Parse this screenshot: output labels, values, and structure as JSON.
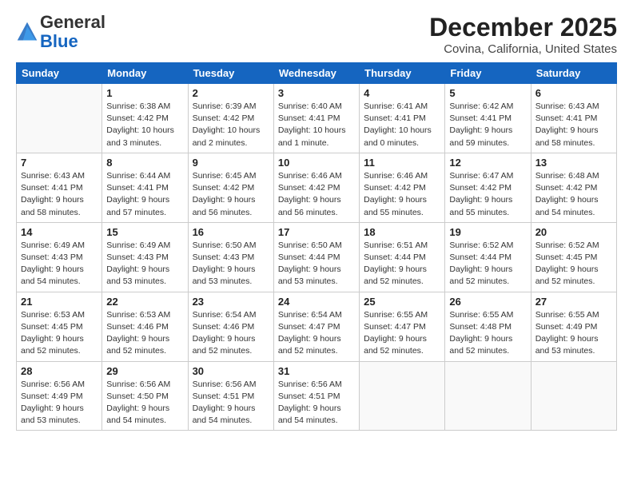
{
  "logo": {
    "general": "General",
    "blue": "Blue"
  },
  "header": {
    "month": "December 2025",
    "location": "Covina, California, United States"
  },
  "weekdays": [
    "Sunday",
    "Monday",
    "Tuesday",
    "Wednesday",
    "Thursday",
    "Friday",
    "Saturday"
  ],
  "weeks": [
    [
      {
        "day": "",
        "sunrise": "",
        "sunset": "",
        "daylight": ""
      },
      {
        "day": "1",
        "sunrise": "Sunrise: 6:38 AM",
        "sunset": "Sunset: 4:42 PM",
        "daylight": "Daylight: 10 hours and 3 minutes."
      },
      {
        "day": "2",
        "sunrise": "Sunrise: 6:39 AM",
        "sunset": "Sunset: 4:42 PM",
        "daylight": "Daylight: 10 hours and 2 minutes."
      },
      {
        "day": "3",
        "sunrise": "Sunrise: 6:40 AM",
        "sunset": "Sunset: 4:41 PM",
        "daylight": "Daylight: 10 hours and 1 minute."
      },
      {
        "day": "4",
        "sunrise": "Sunrise: 6:41 AM",
        "sunset": "Sunset: 4:41 PM",
        "daylight": "Daylight: 10 hours and 0 minutes."
      },
      {
        "day": "5",
        "sunrise": "Sunrise: 6:42 AM",
        "sunset": "Sunset: 4:41 PM",
        "daylight": "Daylight: 9 hours and 59 minutes."
      },
      {
        "day": "6",
        "sunrise": "Sunrise: 6:43 AM",
        "sunset": "Sunset: 4:41 PM",
        "daylight": "Daylight: 9 hours and 58 minutes."
      }
    ],
    [
      {
        "day": "7",
        "sunrise": "Sunrise: 6:43 AM",
        "sunset": "Sunset: 4:41 PM",
        "daylight": "Daylight: 9 hours and 58 minutes."
      },
      {
        "day": "8",
        "sunrise": "Sunrise: 6:44 AM",
        "sunset": "Sunset: 4:41 PM",
        "daylight": "Daylight: 9 hours and 57 minutes."
      },
      {
        "day": "9",
        "sunrise": "Sunrise: 6:45 AM",
        "sunset": "Sunset: 4:42 PM",
        "daylight": "Daylight: 9 hours and 56 minutes."
      },
      {
        "day": "10",
        "sunrise": "Sunrise: 6:46 AM",
        "sunset": "Sunset: 4:42 PM",
        "daylight": "Daylight: 9 hours and 56 minutes."
      },
      {
        "day": "11",
        "sunrise": "Sunrise: 6:46 AM",
        "sunset": "Sunset: 4:42 PM",
        "daylight": "Daylight: 9 hours and 55 minutes."
      },
      {
        "day": "12",
        "sunrise": "Sunrise: 6:47 AM",
        "sunset": "Sunset: 4:42 PM",
        "daylight": "Daylight: 9 hours and 55 minutes."
      },
      {
        "day": "13",
        "sunrise": "Sunrise: 6:48 AM",
        "sunset": "Sunset: 4:42 PM",
        "daylight": "Daylight: 9 hours and 54 minutes."
      }
    ],
    [
      {
        "day": "14",
        "sunrise": "Sunrise: 6:49 AM",
        "sunset": "Sunset: 4:43 PM",
        "daylight": "Daylight: 9 hours and 54 minutes."
      },
      {
        "day": "15",
        "sunrise": "Sunrise: 6:49 AM",
        "sunset": "Sunset: 4:43 PM",
        "daylight": "Daylight: 9 hours and 53 minutes."
      },
      {
        "day": "16",
        "sunrise": "Sunrise: 6:50 AM",
        "sunset": "Sunset: 4:43 PM",
        "daylight": "Daylight: 9 hours and 53 minutes."
      },
      {
        "day": "17",
        "sunrise": "Sunrise: 6:50 AM",
        "sunset": "Sunset: 4:44 PM",
        "daylight": "Daylight: 9 hours and 53 minutes."
      },
      {
        "day": "18",
        "sunrise": "Sunrise: 6:51 AM",
        "sunset": "Sunset: 4:44 PM",
        "daylight": "Daylight: 9 hours and 52 minutes."
      },
      {
        "day": "19",
        "sunrise": "Sunrise: 6:52 AM",
        "sunset": "Sunset: 4:44 PM",
        "daylight": "Daylight: 9 hours and 52 minutes."
      },
      {
        "day": "20",
        "sunrise": "Sunrise: 6:52 AM",
        "sunset": "Sunset: 4:45 PM",
        "daylight": "Daylight: 9 hours and 52 minutes."
      }
    ],
    [
      {
        "day": "21",
        "sunrise": "Sunrise: 6:53 AM",
        "sunset": "Sunset: 4:45 PM",
        "daylight": "Daylight: 9 hours and 52 minutes."
      },
      {
        "day": "22",
        "sunrise": "Sunrise: 6:53 AM",
        "sunset": "Sunset: 4:46 PM",
        "daylight": "Daylight: 9 hours and 52 minutes."
      },
      {
        "day": "23",
        "sunrise": "Sunrise: 6:54 AM",
        "sunset": "Sunset: 4:46 PM",
        "daylight": "Daylight: 9 hours and 52 minutes."
      },
      {
        "day": "24",
        "sunrise": "Sunrise: 6:54 AM",
        "sunset": "Sunset: 4:47 PM",
        "daylight": "Daylight: 9 hours and 52 minutes."
      },
      {
        "day": "25",
        "sunrise": "Sunrise: 6:55 AM",
        "sunset": "Sunset: 4:47 PM",
        "daylight": "Daylight: 9 hours and 52 minutes."
      },
      {
        "day": "26",
        "sunrise": "Sunrise: 6:55 AM",
        "sunset": "Sunset: 4:48 PM",
        "daylight": "Daylight: 9 hours and 52 minutes."
      },
      {
        "day": "27",
        "sunrise": "Sunrise: 6:55 AM",
        "sunset": "Sunset: 4:49 PM",
        "daylight": "Daylight: 9 hours and 53 minutes."
      }
    ],
    [
      {
        "day": "28",
        "sunrise": "Sunrise: 6:56 AM",
        "sunset": "Sunset: 4:49 PM",
        "daylight": "Daylight: 9 hours and 53 minutes."
      },
      {
        "day": "29",
        "sunrise": "Sunrise: 6:56 AM",
        "sunset": "Sunset: 4:50 PM",
        "daylight": "Daylight: 9 hours and 54 minutes."
      },
      {
        "day": "30",
        "sunrise": "Sunrise: 6:56 AM",
        "sunset": "Sunset: 4:51 PM",
        "daylight": "Daylight: 9 hours and 54 minutes."
      },
      {
        "day": "31",
        "sunrise": "Sunrise: 6:56 AM",
        "sunset": "Sunset: 4:51 PM",
        "daylight": "Daylight: 9 hours and 54 minutes."
      },
      {
        "day": "",
        "sunrise": "",
        "sunset": "",
        "daylight": ""
      },
      {
        "day": "",
        "sunrise": "",
        "sunset": "",
        "daylight": ""
      },
      {
        "day": "",
        "sunrise": "",
        "sunset": "",
        "daylight": ""
      }
    ]
  ]
}
